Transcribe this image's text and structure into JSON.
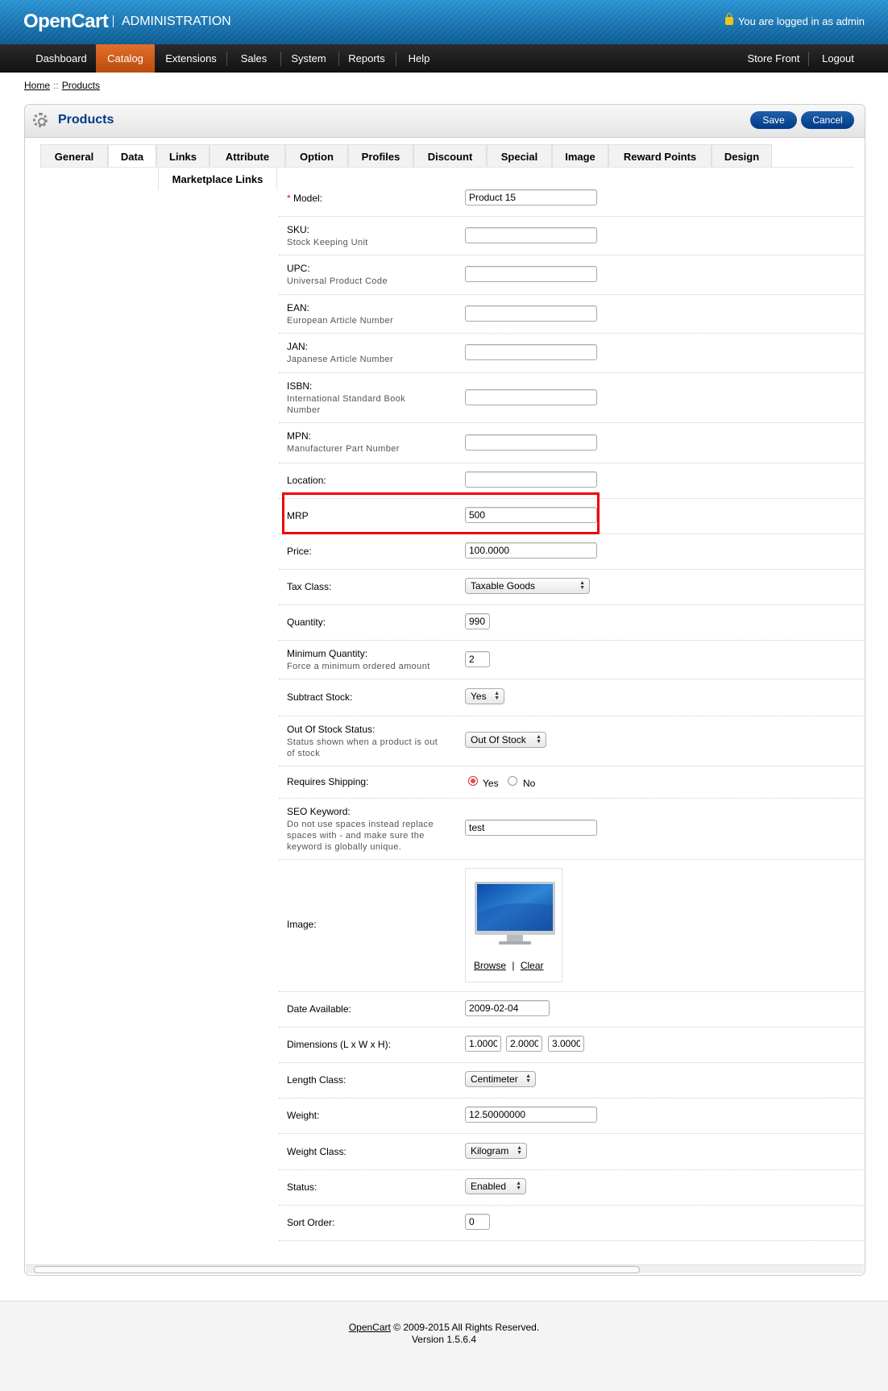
{
  "header": {
    "logo": "OpenCart",
    "admin_label": "ADMINISTRATION",
    "login_text": "You are logged in as admin"
  },
  "menu": {
    "left": [
      "Dashboard",
      "Catalog",
      "Extensions",
      "Sales",
      "System",
      "Reports",
      "Help"
    ],
    "active": "Catalog",
    "right": [
      "Store Front",
      "Logout"
    ]
  },
  "breadcrumb": {
    "home": "Home",
    "sep": "::",
    "current": "Products"
  },
  "box": {
    "title": "Products",
    "save": "Save",
    "cancel": "Cancel"
  },
  "tabs": [
    "General",
    "Data",
    "Links",
    "Attribute",
    "Option",
    "Profiles",
    "Discount",
    "Special",
    "Image",
    "Reward Points",
    "Design",
    "Marketplace Links"
  ],
  "active_tab": "Data",
  "form": {
    "model": {
      "label": "Model:",
      "value": "Product 15",
      "required_mark": "*"
    },
    "sku": {
      "label": "SKU:",
      "help": "Stock Keeping Unit",
      "value": ""
    },
    "upc": {
      "label": "UPC:",
      "help": "Universal Product Code",
      "value": ""
    },
    "ean": {
      "label": "EAN:",
      "help": "European Article Number",
      "value": ""
    },
    "jan": {
      "label": "JAN:",
      "help": "Japanese Article Number",
      "value": ""
    },
    "isbn": {
      "label": "ISBN:",
      "help": "International Standard Book Number",
      "value": ""
    },
    "mpn": {
      "label": "MPN:",
      "help": "Manufacturer Part Number",
      "value": ""
    },
    "location": {
      "label": "Location:",
      "value": ""
    },
    "mrp": {
      "label": "MRP",
      "value": "500"
    },
    "price": {
      "label": "Price:",
      "value": "100.0000"
    },
    "tax_class": {
      "label": "Tax Class:",
      "value": "Taxable Goods"
    },
    "quantity": {
      "label": "Quantity:",
      "value": "990"
    },
    "minimum": {
      "label": "Minimum Quantity:",
      "help": "Force a minimum ordered amount",
      "value": "2"
    },
    "subtract": {
      "label": "Subtract Stock:",
      "value": "Yes"
    },
    "stock_status": {
      "label": "Out Of Stock Status:",
      "help": "Status shown when a product is out of stock",
      "value": "Out Of Stock"
    },
    "shipping": {
      "label": "Requires Shipping:",
      "yes": "Yes",
      "no": "No",
      "selected": "Yes"
    },
    "keyword": {
      "label": "SEO Keyword:",
      "help": "Do not use spaces instead replace spaces with - and make sure the keyword is globally unique.",
      "value": "test"
    },
    "image": {
      "label": "Image:",
      "browse": "Browse",
      "sep": "|",
      "clear": "Clear"
    },
    "date_available": {
      "label": "Date Available:",
      "value": "2009-02-04"
    },
    "dimensions": {
      "label": "Dimensions (L x W x H):",
      "length": "1.00000",
      "width": "2.00000",
      "height": "3.00000"
    },
    "length_class": {
      "label": "Length Class:",
      "value": "Centimeter"
    },
    "weight": {
      "label": "Weight:",
      "value": "12.50000000"
    },
    "weight_class": {
      "label": "Weight Class:",
      "value": "Kilogram"
    },
    "status": {
      "label": "Status:",
      "value": "Enabled"
    },
    "sort_order": {
      "label": "Sort Order:",
      "value": "0"
    }
  },
  "footer": {
    "link": "OpenCart",
    "copyright": "© 2009-2015 All Rights Reserved.",
    "version": "Version 1.5.6.4"
  }
}
